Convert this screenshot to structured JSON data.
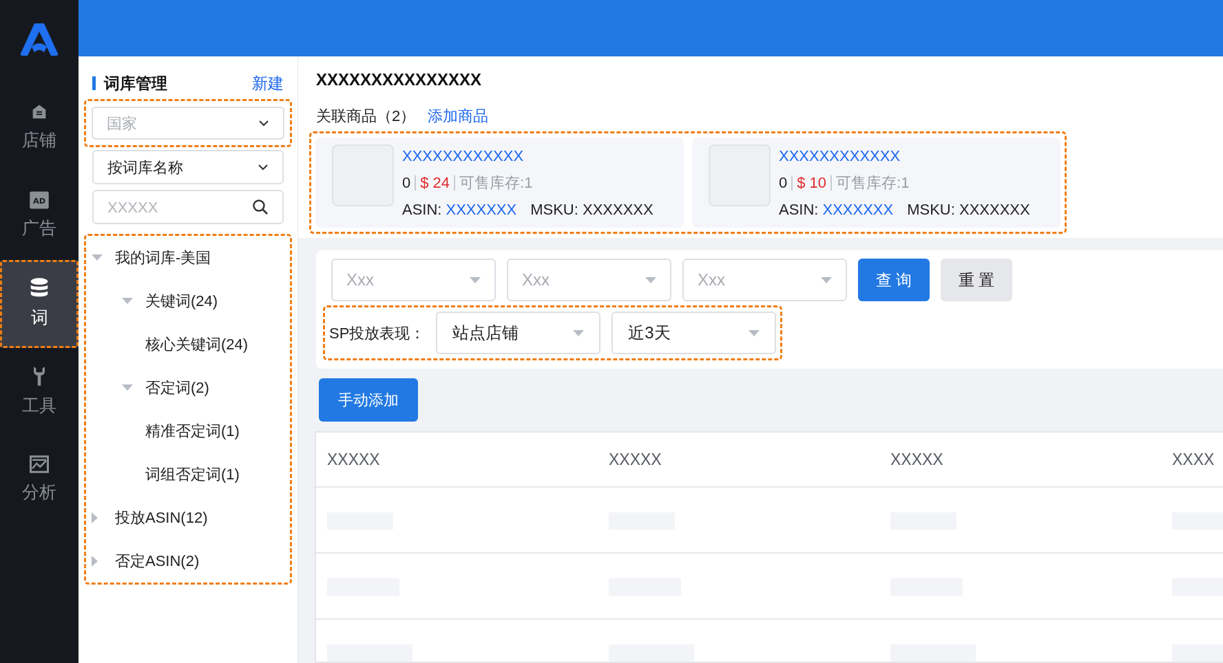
{
  "nav": {
    "items": [
      {
        "label": "店铺",
        "selected": false
      },
      {
        "label": "广告",
        "selected": false,
        "icon_text": "AD"
      },
      {
        "label": "词",
        "selected": true
      },
      {
        "label": "工具",
        "selected": false
      },
      {
        "label": "分析",
        "selected": false
      }
    ]
  },
  "library_panel": {
    "title": "词库管理",
    "new_link": "新建",
    "country_select": {
      "placeholder": "国家"
    },
    "sort_select": {
      "value": "按词库名称"
    },
    "search": {
      "placeholder": "XXXXX"
    },
    "tree": [
      {
        "label": "我的词库-美国",
        "kind": "folder",
        "expanded": true,
        "children": [
          {
            "label": "关键词(24)",
            "kind": "folder",
            "expanded": true,
            "children": [
              {
                "label": "核心关键词(24)",
                "kind": "leaf"
              }
            ]
          },
          {
            "label": "否定词(2)",
            "kind": "folder",
            "expanded": true,
            "children": [
              {
                "label": "精准否定词(1)",
                "kind": "leaf"
              },
              {
                "label": "词组否定词(1)",
                "kind": "leaf"
              }
            ]
          }
        ]
      },
      {
        "label": "投放ASIN(12)",
        "kind": "folder",
        "expanded": false
      },
      {
        "label": "否定ASIN(2)",
        "kind": "folder",
        "expanded": false
      }
    ]
  },
  "detail": {
    "title": "XXXXXXXXXXXXXXX",
    "linked_label": "关联商品（2）",
    "add_link": "添加商品",
    "products": [
      {
        "name": "XXXXXXXXXXXX",
        "count": "0",
        "price": "$ 24",
        "stock": "可售库存:1",
        "asin_label": "ASIN:",
        "asin": "XXXXXXX",
        "msku": "MSKU: XXXXXXX"
      },
      {
        "name": "XXXXXXXXXXXX",
        "count": "0",
        "price": "$ 10",
        "stock": "可售库存:1",
        "asin_label": "ASIN:",
        "asin": "XXXXXXX",
        "msku": "MSKU: XXXXXXX"
      }
    ]
  },
  "filters": {
    "selects": [
      {
        "placeholder": "Xxx"
      },
      {
        "placeholder": "Xxx"
      },
      {
        "placeholder": "Xxx"
      }
    ],
    "query_button": "查 询",
    "reset_button": "重 置",
    "sp_label": "SP投放表现：",
    "sp_selects": [
      {
        "value": "站点店铺"
      },
      {
        "value": "近3天"
      }
    ]
  },
  "add_button": "手动添加",
  "table": {
    "columns": [
      "XXXXX",
      "XXXXX",
      "XXXXX",
      "XXXX"
    ],
    "rows": [
      {
        "kind": "skeleton"
      },
      {
        "kind": "skeleton"
      },
      {
        "kind": "skeleton"
      }
    ]
  }
}
